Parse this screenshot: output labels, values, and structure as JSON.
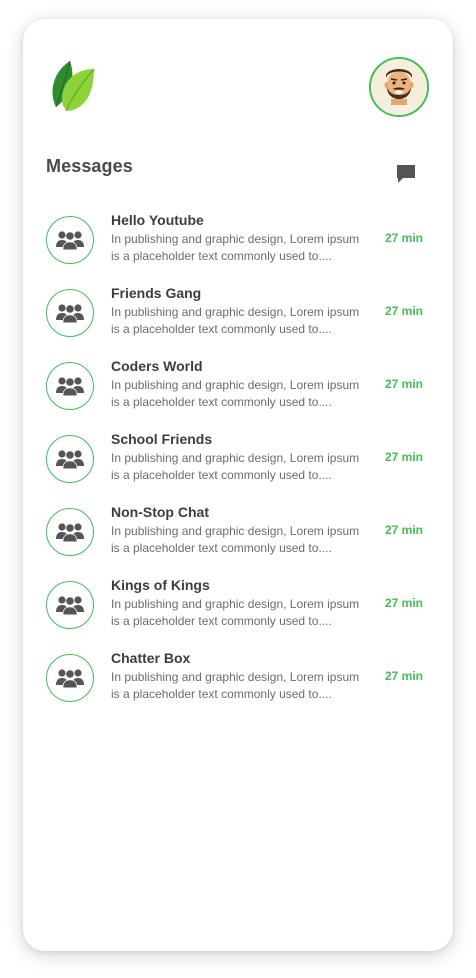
{
  "header": {
    "logo_icon": "leaf-logo-icon",
    "avatar_icon": "user-avatar-icon"
  },
  "messages": {
    "title": "Messages",
    "compose_icon": "chat-bubble-icon",
    "items": [
      {
        "name": "Hello Youtube",
        "preview": "In publishing and graphic design, Lorem ipsum is a placeholder text commonly used to....",
        "time": "27 min"
      },
      {
        "name": "Friends Gang",
        "preview": "In publishing and graphic design, Lorem ipsum is a placeholder text commonly used to....",
        "time": "27 min"
      },
      {
        "name": "Coders World",
        "preview": "In publishing and graphic design, Lorem ipsum is a placeholder text commonly used to....",
        "time": "27 min"
      },
      {
        "name": "School Friends",
        "preview": "In publishing and graphic design, Lorem ipsum is a placeholder text commonly used to....",
        "time": "27 min"
      },
      {
        "name": "Non-Stop Chat",
        "preview": "In publishing and graphic design, Lorem ipsum is a placeholder text commonly used to....",
        "time": "27 min"
      },
      {
        "name": "Kings of Kings",
        "preview": "In publishing and graphic design, Lorem ipsum is a placeholder text commonly used to....",
        "time": "27 min"
      },
      {
        "name": "Chatter Box",
        "preview": "In publishing and graphic design, Lorem ipsum is a placeholder text commonly used to....",
        "time": "27 min"
      }
    ]
  },
  "colors": {
    "accent": "#3fbf55",
    "title": "#4a4a4a",
    "text": "#6c6c6c",
    "icon": "#555555"
  }
}
